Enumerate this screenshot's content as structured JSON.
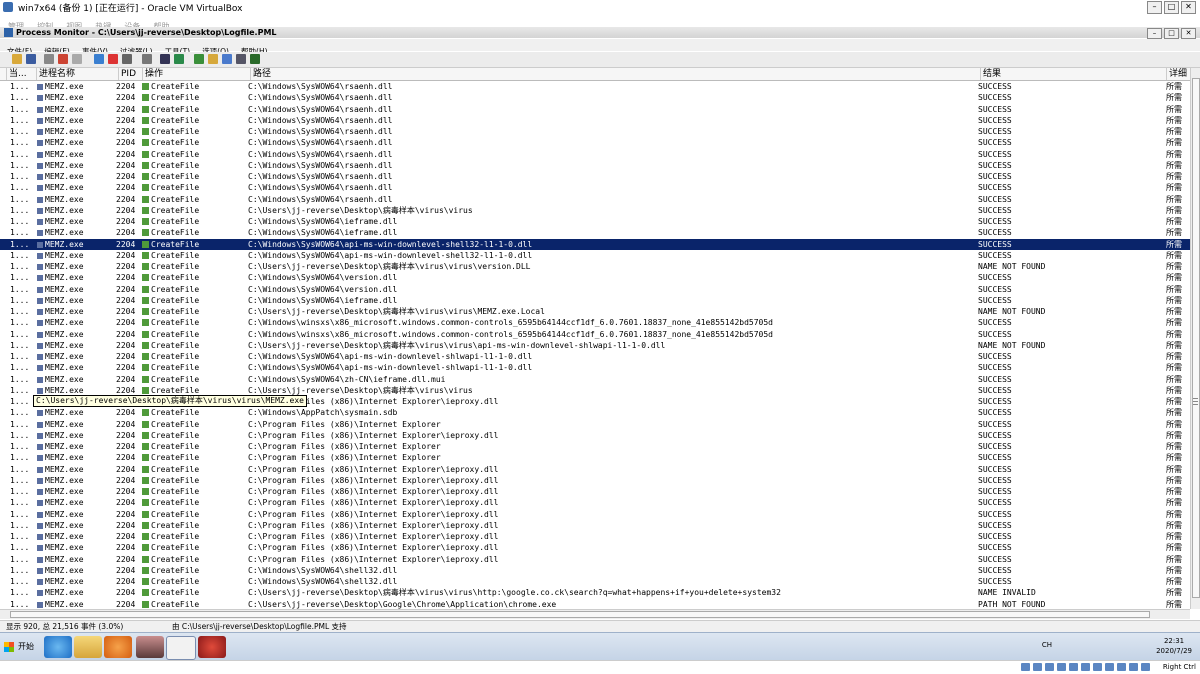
{
  "vbox": {
    "title": "win7x64 (备份 1) [正在运行] - Oracle VM VirtualBox",
    "menu": [
      "管理",
      "控制",
      "视图",
      "热键",
      "设备",
      "帮助"
    ]
  },
  "procmon": {
    "title": "Process Monitor - C:\\Users\\jj-reverse\\Desktop\\Logfile.PML",
    "menu": [
      "文件(F)",
      "编辑(E)",
      "事件(V)",
      "过滤器(L)",
      "工具(T)",
      "选项(O)",
      "帮助(H)"
    ],
    "columns": [
      "当...",
      "进程名称",
      "PID",
      "操作",
      "路径",
      "结果",
      "详细"
    ],
    "rows": [
      {
        "seq": "1...",
        "proc": "MEMZ.exe",
        "pid": "2204",
        "op": "CreateFile",
        "path": "C:\\Windows\\SysWOW64\\rsaenh.dll",
        "result": "SUCCESS",
        "detail": "所需"
      },
      {
        "seq": "1...",
        "proc": "MEMZ.exe",
        "pid": "2204",
        "op": "CreateFile",
        "path": "C:\\Windows\\SysWOW64\\rsaenh.dll",
        "result": "SUCCESS",
        "detail": "所需"
      },
      {
        "seq": "1...",
        "proc": "MEMZ.exe",
        "pid": "2204",
        "op": "CreateFile",
        "path": "C:\\Windows\\SysWOW64\\rsaenh.dll",
        "result": "SUCCESS",
        "detail": "所需"
      },
      {
        "seq": "1...",
        "proc": "MEMZ.exe",
        "pid": "2204",
        "op": "CreateFile",
        "path": "C:\\Windows\\SysWOW64\\rsaenh.dll",
        "result": "SUCCESS",
        "detail": "所需"
      },
      {
        "seq": "1...",
        "proc": "MEMZ.exe",
        "pid": "2204",
        "op": "CreateFile",
        "path": "C:\\Windows\\SysWOW64\\rsaenh.dll",
        "result": "SUCCESS",
        "detail": "所需"
      },
      {
        "seq": "1...",
        "proc": "MEMZ.exe",
        "pid": "2204",
        "op": "CreateFile",
        "path": "C:\\Windows\\SysWOW64\\rsaenh.dll",
        "result": "SUCCESS",
        "detail": "所需"
      },
      {
        "seq": "1...",
        "proc": "MEMZ.exe",
        "pid": "2204",
        "op": "CreateFile",
        "path": "C:\\Windows\\SysWOW64\\rsaenh.dll",
        "result": "SUCCESS",
        "detail": "所需"
      },
      {
        "seq": "1...",
        "proc": "MEMZ.exe",
        "pid": "2204",
        "op": "CreateFile",
        "path": "C:\\Windows\\SysWOW64\\rsaenh.dll",
        "result": "SUCCESS",
        "detail": "所需"
      },
      {
        "seq": "1...",
        "proc": "MEMZ.exe",
        "pid": "2204",
        "op": "CreateFile",
        "path": "C:\\Windows\\SysWOW64\\rsaenh.dll",
        "result": "SUCCESS",
        "detail": "所需"
      },
      {
        "seq": "1...",
        "proc": "MEMZ.exe",
        "pid": "2204",
        "op": "CreateFile",
        "path": "C:\\Windows\\SysWOW64\\rsaenh.dll",
        "result": "SUCCESS",
        "detail": "所需"
      },
      {
        "seq": "1...",
        "proc": "MEMZ.exe",
        "pid": "2204",
        "op": "CreateFile",
        "path": "C:\\Windows\\SysWOW64\\rsaenh.dll",
        "result": "SUCCESS",
        "detail": "所需"
      },
      {
        "seq": "1...",
        "proc": "MEMZ.exe",
        "pid": "2204",
        "op": "CreateFile",
        "path": "C:\\Users\\jj-reverse\\Desktop\\病毒样本\\virus\\virus",
        "result": "SUCCESS",
        "detail": "所需"
      },
      {
        "seq": "1...",
        "proc": "MEMZ.exe",
        "pid": "2204",
        "op": "CreateFile",
        "path": "C:\\Windows\\SysWOW64\\ieframe.dll",
        "result": "SUCCESS",
        "detail": "所需"
      },
      {
        "seq": "1...",
        "proc": "MEMZ.exe",
        "pid": "2204",
        "op": "CreateFile",
        "path": "C:\\Windows\\SysWOW64\\ieframe.dll",
        "result": "SUCCESS",
        "detail": "所需"
      },
      {
        "seq": "1...",
        "proc": "MEMZ.exe",
        "pid": "2204",
        "op": "CreateFile",
        "path": "C:\\Windows\\SysWOW64\\api-ms-win-downlevel-shell32-l1-1-0.dll",
        "result": "SUCCESS",
        "detail": "所需",
        "selected": true
      },
      {
        "seq": "1...",
        "proc": "MEMZ.exe",
        "pid": "2204",
        "op": "CreateFile",
        "path": "C:\\Windows\\SysWOW64\\api-ms-win-downlevel-shell32-l1-1-0.dll",
        "result": "SUCCESS",
        "detail": "所需"
      },
      {
        "seq": "1...",
        "proc": "MEMZ.exe",
        "pid": "2204",
        "op": "CreateFile",
        "path": "C:\\Users\\jj-reverse\\Desktop\\病毒样本\\virus\\virus\\version.DLL",
        "result": "NAME NOT FOUND",
        "detail": "所需"
      },
      {
        "seq": "1...",
        "proc": "MEMZ.exe",
        "pid": "2204",
        "op": "CreateFile",
        "path": "C:\\Windows\\SysWOW64\\version.dll",
        "result": "SUCCESS",
        "detail": "所需"
      },
      {
        "seq": "1...",
        "proc": "MEMZ.exe",
        "pid": "2204",
        "op": "CreateFile",
        "path": "C:\\Windows\\SysWOW64\\version.dll",
        "result": "SUCCESS",
        "detail": "所需"
      },
      {
        "seq": "1...",
        "proc": "MEMZ.exe",
        "pid": "2204",
        "op": "CreateFile",
        "path": "C:\\Windows\\SysWOW64\\ieframe.dll",
        "result": "SUCCESS",
        "detail": "所需"
      },
      {
        "seq": "1...",
        "proc": "MEMZ.exe",
        "pid": "2204",
        "op": "CreateFile",
        "path": "C:\\Users\\jj-reverse\\Desktop\\病毒样本\\virus\\virus\\MEMZ.exe.Local",
        "result": "NAME NOT FOUND",
        "detail": "所需"
      },
      {
        "seq": "1...",
        "proc": "MEMZ.exe",
        "pid": "2204",
        "op": "CreateFile",
        "path": "C:\\Windows\\winsxs\\x86_microsoft.windows.common-controls_6595b64144ccf1df_6.0.7601.18837_none_41e855142bd5705d",
        "result": "SUCCESS",
        "detail": "所需"
      },
      {
        "seq": "1...",
        "proc": "MEMZ.exe",
        "pid": "2204",
        "op": "CreateFile",
        "path": "C:\\Windows\\winsxs\\x86_microsoft.windows.common-controls_6595b64144ccf1df_6.0.7601.18837_none_41e855142bd5705d",
        "result": "SUCCESS",
        "detail": "所需"
      },
      {
        "seq": "1...",
        "proc": "MEMZ.exe",
        "pid": "2204",
        "op": "CreateFile",
        "path": "C:\\Users\\jj-reverse\\Desktop\\病毒样本\\virus\\virus\\api-ms-win-downlevel-shlwapi-l1-1-0.dll",
        "result": "NAME NOT FOUND",
        "detail": "所需"
      },
      {
        "seq": "1...",
        "proc": "MEMZ.exe",
        "pid": "2204",
        "op": "CreateFile",
        "path": "C:\\Windows\\SysWOW64\\api-ms-win-downlevel-shlwapi-l1-1-0.dll",
        "result": "SUCCESS",
        "detail": "所需"
      },
      {
        "seq": "1...",
        "proc": "MEMZ.exe",
        "pid": "2204",
        "op": "CreateFile",
        "path": "C:\\Windows\\SysWOW64\\api-ms-win-downlevel-shlwapi-l1-1-0.dll",
        "result": "SUCCESS",
        "detail": "所需"
      },
      {
        "seq": "1...",
        "proc": "MEMZ.exe",
        "pid": "2204",
        "op": "CreateFile",
        "path": "C:\\Windows\\SysWOW64\\zh-CN\\ieframe.dll.mui",
        "result": "SUCCESS",
        "detail": "所需"
      },
      {
        "seq": "1...",
        "proc": "MEMZ.exe",
        "pid": "2204",
        "op": "CreateFile",
        "path": "C:\\Users\\jj-reverse\\Desktop\\病毒样本\\virus\\virus",
        "result": "SUCCESS",
        "detail": "所需"
      },
      {
        "seq": "1...",
        "proc": "MEMZ.exe",
        "pid": "2204",
        "op": "CreateFile",
        "path": "C:\\Program Files (x86)\\Internet Explorer\\ieproxy.dll",
        "result": "SUCCESS",
        "detail": "所需"
      },
      {
        "seq": "1...",
        "proc": "MEMZ.exe",
        "pid": "2204",
        "op": "CreateFile",
        "path": "C:\\Windows\\AppPatch\\sysmain.sdb",
        "result": "SUCCESS",
        "detail": "所需"
      },
      {
        "seq": "1...",
        "proc": "MEMZ.exe",
        "pid": "2204",
        "op": "CreateFile",
        "path": "C:\\Program Files (x86)\\Internet Explorer",
        "result": "SUCCESS",
        "detail": "所需"
      },
      {
        "seq": "1...",
        "proc": "MEMZ.exe",
        "pid": "2204",
        "op": "CreateFile",
        "path": "C:\\Program Files (x86)\\Internet Explorer\\ieproxy.dll",
        "result": "SUCCESS",
        "detail": "所需"
      },
      {
        "seq": "1...",
        "proc": "MEMZ.exe",
        "pid": "2204",
        "op": "CreateFile",
        "path": "C:\\Program Files (x86)\\Internet Explorer",
        "result": "SUCCESS",
        "detail": "所需"
      },
      {
        "seq": "1...",
        "proc": "MEMZ.exe",
        "pid": "2204",
        "op": "CreateFile",
        "path": "C:\\Program Files (x86)\\Internet Explorer",
        "result": "SUCCESS",
        "detail": "所需"
      },
      {
        "seq": "1...",
        "proc": "MEMZ.exe",
        "pid": "2204",
        "op": "CreateFile",
        "path": "C:\\Program Files (x86)\\Internet Explorer\\ieproxy.dll",
        "result": "SUCCESS",
        "detail": "所需"
      },
      {
        "seq": "1...",
        "proc": "MEMZ.exe",
        "pid": "2204",
        "op": "CreateFile",
        "path": "C:\\Program Files (x86)\\Internet Explorer\\ieproxy.dll",
        "result": "SUCCESS",
        "detail": "所需"
      },
      {
        "seq": "1...",
        "proc": "MEMZ.exe",
        "pid": "2204",
        "op": "CreateFile",
        "path": "C:\\Program Files (x86)\\Internet Explorer\\ieproxy.dll",
        "result": "SUCCESS",
        "detail": "所需"
      },
      {
        "seq": "1...",
        "proc": "MEMZ.exe",
        "pid": "2204",
        "op": "CreateFile",
        "path": "C:\\Program Files (x86)\\Internet Explorer\\ieproxy.dll",
        "result": "SUCCESS",
        "detail": "所需"
      },
      {
        "seq": "1...",
        "proc": "MEMZ.exe",
        "pid": "2204",
        "op": "CreateFile",
        "path": "C:\\Program Files (x86)\\Internet Explorer\\ieproxy.dll",
        "result": "SUCCESS",
        "detail": "所需"
      },
      {
        "seq": "1...",
        "proc": "MEMZ.exe",
        "pid": "2204",
        "op": "CreateFile",
        "path": "C:\\Program Files (x86)\\Internet Explorer\\ieproxy.dll",
        "result": "SUCCESS",
        "detail": "所需"
      },
      {
        "seq": "1...",
        "proc": "MEMZ.exe",
        "pid": "2204",
        "op": "CreateFile",
        "path": "C:\\Program Files (x86)\\Internet Explorer\\ieproxy.dll",
        "result": "SUCCESS",
        "detail": "所需"
      },
      {
        "seq": "1...",
        "proc": "MEMZ.exe",
        "pid": "2204",
        "op": "CreateFile",
        "path": "C:\\Program Files (x86)\\Internet Explorer\\ieproxy.dll",
        "result": "SUCCESS",
        "detail": "所需"
      },
      {
        "seq": "1...",
        "proc": "MEMZ.exe",
        "pid": "2204",
        "op": "CreateFile",
        "path": "C:\\Program Files (x86)\\Internet Explorer\\ieproxy.dll",
        "result": "SUCCESS",
        "detail": "所需"
      },
      {
        "seq": "1...",
        "proc": "MEMZ.exe",
        "pid": "2204",
        "op": "CreateFile",
        "path": "C:\\Windows\\SysWOW64\\shell32.dll",
        "result": "SUCCESS",
        "detail": "所需"
      },
      {
        "seq": "1...",
        "proc": "MEMZ.exe",
        "pid": "2204",
        "op": "CreateFile",
        "path": "C:\\Windows\\SysWOW64\\shell32.dll",
        "result": "SUCCESS",
        "detail": "所需"
      },
      {
        "seq": "1...",
        "proc": "MEMZ.exe",
        "pid": "2204",
        "op": "CreateFile",
        "path": "C:\\Users\\jj-reverse\\Desktop\\病毒样本\\virus\\virus\\http:\\google.co.ck\\search?q=what+happens+if+you+delete+system32",
        "result": "NAME INVALID",
        "detail": "所需"
      },
      {
        "seq": "1...",
        "proc": "MEMZ.exe",
        "pid": "2204",
        "op": "CreateFile",
        "path": "C:\\Users\\jj-reverse\\Desktop\\Google\\Chrome\\Application\\chrome.exe",
        "result": "PATH NOT FOUND",
        "detail": "所需"
      }
    ],
    "tooltip": "C:\\Users\\jj-reverse\\Desktop\\病毒样本\\virus\\virus\\MEMZ.exe",
    "status": {
      "events": "显示 920, 总 21,516 事件 (3.0%)",
      "backing": "由 C:\\Users\\jj-reverse\\Desktop\\Logfile.PML 支持"
    }
  },
  "taskbar": {
    "start_label": "开始",
    "tray_lang": "CH",
    "time": "22:31",
    "date": "2020/7/29"
  },
  "host": {
    "right_ctrl": "Right Ctrl"
  }
}
